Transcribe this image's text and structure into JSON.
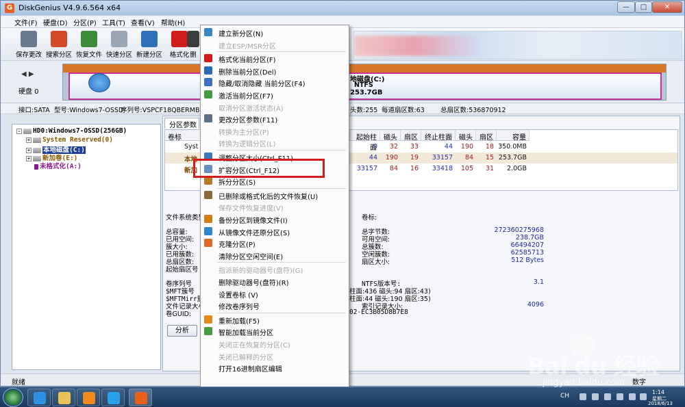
{
  "window": {
    "title": "DiskGenius V4.9.6.564 x64",
    "logo_letter": "G",
    "minimize": "—",
    "maximize": "□",
    "close": "✕"
  },
  "menubar": [
    "文件(F)",
    "硬盘(D)",
    "分区(P)",
    "工具(T)",
    "查看(V)",
    "帮助(H)"
  ],
  "toolbar": [
    {
      "label": "保存更改",
      "icon": "save-icon",
      "color": "#6a7a8e"
    },
    {
      "label": "搜索分区",
      "icon": "search-icon",
      "color": "#d24a2a"
    },
    {
      "label": "恢复文件",
      "icon": "recover-icon",
      "color": "#3d8a3a"
    },
    {
      "label": "快速分区",
      "icon": "quick-partition-icon",
      "color": "#9aa6b3"
    },
    {
      "label": "新建分区",
      "icon": "new-partition-icon",
      "color": "#2d6fb8"
    },
    {
      "label": "格式化",
      "icon": "format-icon",
      "color": "#d01c1c"
    },
    {
      "label": "删",
      "icon": "delete-icon",
      "color": "#3c3c3c"
    }
  ],
  "disk_pane": {
    "nav": "◀ ▶",
    "disk_label": "硬盘 0",
    "partition_name": "地磁盘(C:)",
    "partition_fs": "NTFS",
    "partition_size": "253.7GB"
  },
  "infoline": {
    "iface": "接口:SATA",
    "model": "型号:Windows7-OSSD",
    "serial": "序列号:VSPCF18QBERMB722D",
    "heads": "头数:255",
    "sectors_track": "每道扇区数:63",
    "total_sectors": "总扇区数:536870912"
  },
  "tree": {
    "disk": "HD0:Windows7-OSSD(256GB)",
    "items": [
      "System Reserved(0)",
      "本地磁盘(C:)",
      "新加卷(E:)",
      "未格式化(A:)"
    ],
    "expander": "+",
    "collapse": "-"
  },
  "tabs": [
    "分区参数",
    "浏"
  ],
  "table": {
    "headers": [
      "卷标",
      "起始柱面",
      "磁头",
      "扇区",
      "终止柱面",
      "磁头",
      "扇区",
      "容量"
    ],
    "rows": [
      {
        "label": "Syst",
        "start_cyl": "0",
        "head1": "32",
        "sec1": "33",
        "end_cyl": "44",
        "head2": "190",
        "sec2": "18",
        "size": "350.0MB"
      },
      {
        "label": "本地",
        "start_cyl": "44",
        "head1": "190",
        "sec1": "19",
        "end_cyl": "33157",
        "head2": "84",
        "sec2": "15",
        "size": "253.7GB"
      },
      {
        "label": "新加",
        "start_cyl": "33157",
        "head1": "84",
        "sec1": "16",
        "end_cyl": "33418",
        "head2": "105",
        "sec2": "31",
        "size": "2.0GB"
      }
    ]
  },
  "details": {
    "fs_type": "文件系统类型",
    "left_labels": [
      "总容量:",
      "已用空间:",
      "簇大小:",
      "已用簇数:",
      "总扇区数:",
      "起始扇区号"
    ],
    "left_labels2": [
      "卷序列号",
      "$MFT簇号",
      "$MFTMirr簇号",
      "文件记录大小",
      "卷GUID:"
    ],
    "volume_label": "卷标:",
    "right_labels": [
      "总字节数:",
      "可用空间:",
      "总簇数:",
      "空闲簇数:",
      "扇区大小:"
    ],
    "right_values": [
      "272360275968",
      "238.7GB",
      "66494207",
      "62585713",
      "512 Bytes"
    ],
    "ntfs_version_label": "NTFS版本号:",
    "ntfs_version": "3.1",
    "mft_loc": "柱面:436 磁头:94 扇区:43)",
    "mftmirr_loc": "柱面:44 磁头:190 扇区:35)",
    "index_size_label": "索引记录大小:",
    "index_size": "4096",
    "guid_tail": "02-EC3B05D8B7E8",
    "analyze": "分析"
  },
  "context_menu": [
    {
      "label": "建立新分区(N)",
      "disabled": false,
      "icon": "new-partition-icon",
      "color": "#3a86c8"
    },
    {
      "label": "建立ESP/MSR分区",
      "disabled": true,
      "icon": "blank",
      "color": "transparent"
    },
    {
      "label": "格式化当前分区(F)",
      "disabled": false,
      "icon": "format-icon",
      "color": "#d01c1c"
    },
    {
      "label": "删除当前分区(Del)",
      "disabled": false,
      "icon": "delete-icon",
      "color": "#2b6bb5"
    },
    {
      "label": "隐藏/取消隐藏 当前分区(F4)",
      "disabled": false,
      "icon": "hide-icon",
      "color": "#3b6fc0"
    },
    {
      "label": "激活当前分区(F7)",
      "disabled": false,
      "icon": "activate-icon",
      "color": "#4a9a44"
    },
    {
      "label": "取消分区激活状态(A)",
      "disabled": true,
      "icon": "blank",
      "color": "transparent"
    },
    {
      "label": "更改分区参数(F11)",
      "disabled": false,
      "icon": "params-icon",
      "color": "#5f6f86"
    },
    {
      "label": "转换为主分区(P)",
      "disabled": true,
      "icon": "blank",
      "color": "transparent"
    },
    {
      "label": "转换为逻辑分区(L)",
      "disabled": true,
      "icon": "blank",
      "color": "transparent"
    },
    {
      "label": "调整分区大小(Ctrl_F11)",
      "disabled": false,
      "icon": "resize-icon",
      "color": "#3a78c0"
    },
    {
      "label": "扩容分区(Ctrl_F12)",
      "disabled": false,
      "icon": "extend-icon",
      "color": "#6a8fbf"
    },
    {
      "label": "拆分分区(S)",
      "disabled": false,
      "icon": "split-icon",
      "color": "#b57a2a"
    },
    {
      "label": "已删除或格式化后的文件恢复(U)",
      "disabled": false,
      "icon": "recover-icon",
      "color": "#8a6a3a"
    },
    {
      "label": "保存文件恢复进度(V)",
      "disabled": true,
      "icon": "blank",
      "color": "transparent"
    },
    {
      "label": "备份分区到镜像文件(I)",
      "disabled": false,
      "icon": "backup-icon",
      "color": "#d07a1a"
    },
    {
      "label": "从镜像文件还原分区(S)",
      "disabled": false,
      "icon": "restore-icon",
      "color": "#2f86c8"
    },
    {
      "label": "克隆分区(P)",
      "disabled": false,
      "icon": "clone-icon",
      "color": "#e06a2a"
    },
    {
      "label": "清除分区空闲空间(E)",
      "disabled": false,
      "icon": "blank",
      "color": "transparent"
    },
    {
      "label": "指派新的驱动器号(盘符)(G)",
      "disabled": true,
      "icon": "blank",
      "color": "transparent"
    },
    {
      "label": "删除驱动器号(盘符)(R)",
      "disabled": false,
      "icon": "blank",
      "color": "transparent"
    },
    {
      "label": "设置卷标 (V)",
      "disabled": false,
      "icon": "blank",
      "color": "transparent"
    },
    {
      "label": "修改卷序列号",
      "disabled": false,
      "icon": "blank",
      "color": "transparent"
    },
    {
      "label": "重新加载(F5)",
      "disabled": false,
      "icon": "reload-icon",
      "color": "#e08a1a"
    },
    {
      "label": "智能加载当前分区",
      "disabled": false,
      "icon": "smart-load-icon",
      "color": "#4a9a44"
    },
    {
      "label": "关闭正在恢复的分区(C)",
      "disabled": true,
      "icon": "blank",
      "color": "transparent"
    },
    {
      "label": "关闭已解释的分区",
      "disabled": true,
      "icon": "blank",
      "color": "transparent"
    },
    {
      "label": "打开16进制扇区编辑",
      "disabled": false,
      "icon": "blank",
      "color": "transparent"
    }
  ],
  "statusbar": {
    "text": "就绪",
    "num": "数字"
  },
  "taskbar": {
    "apps": [
      {
        "icon": "ie-icon",
        "color": "#2f8fe0"
      },
      {
        "icon": "folder-icon",
        "color": "#e7c35a"
      },
      {
        "icon": "media-player-icon",
        "color": "#f08a1c"
      },
      {
        "icon": "chat-icon",
        "color": "#2aa0e8"
      },
      {
        "icon": "diskgenius-icon",
        "color": "#e8601c"
      }
    ],
    "lang": "CH",
    "time": "1:14",
    "day": "星期二",
    "date": "2018/6/13"
  },
  "watermark": {
    "logo": "Bai du 经验",
    "url": "jingyan.baidu.com"
  }
}
